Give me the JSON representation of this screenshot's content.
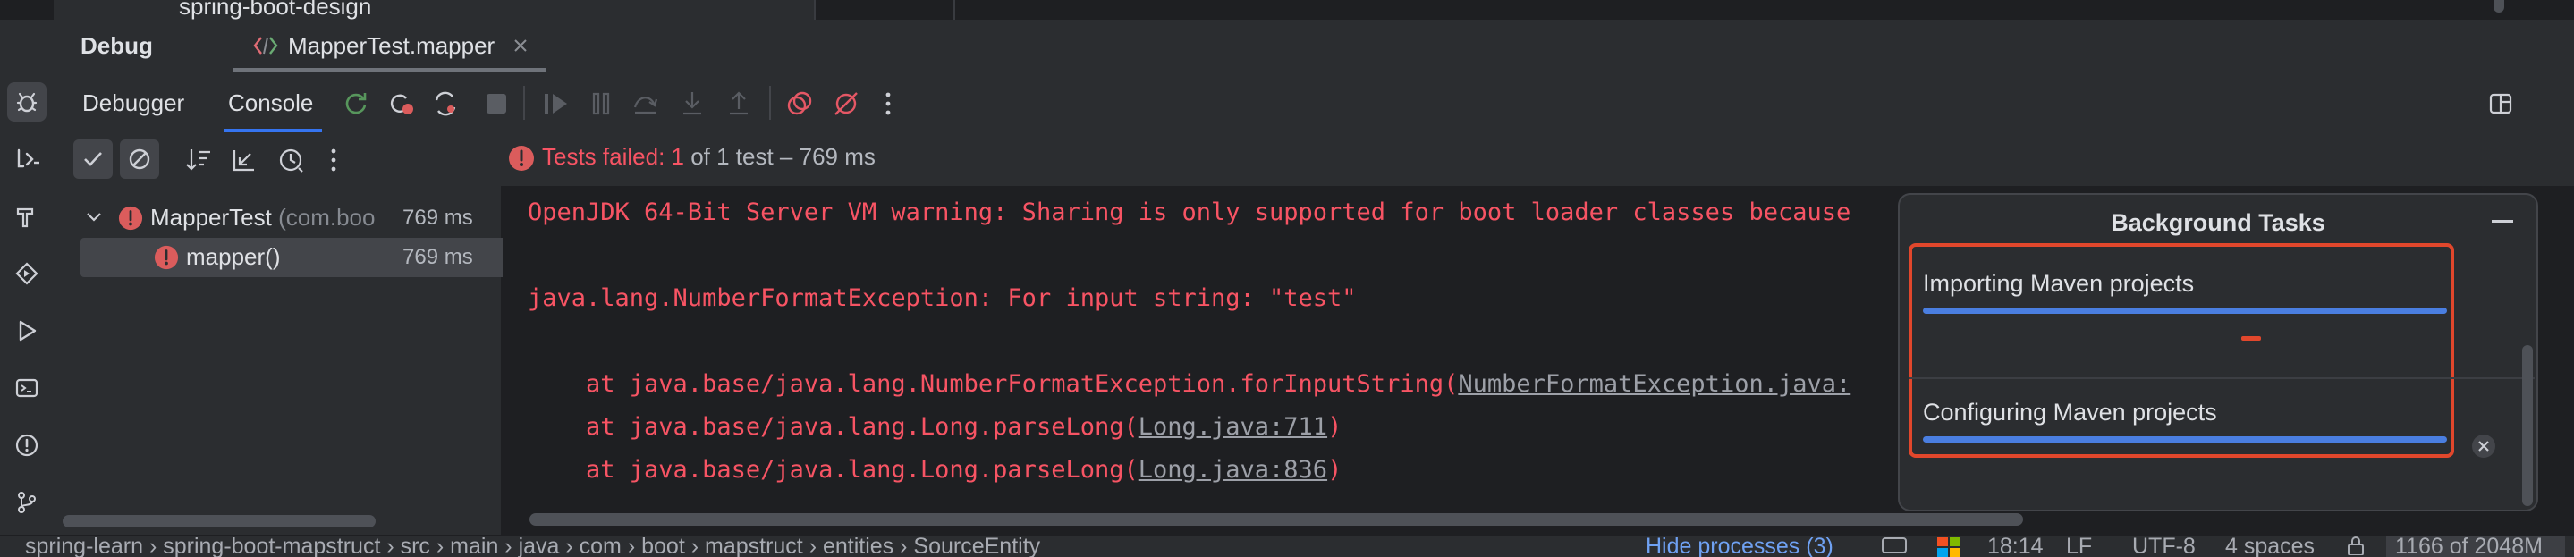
{
  "top": {
    "project_tree_remnant": "spring-boot-design"
  },
  "debug_panel": {
    "title": "Debug",
    "tab_label": "MapperTest.mapper",
    "tool_tabs": [
      "Debugger",
      "Console"
    ]
  },
  "runner": {
    "status_prefix": "Tests failed: 1",
    "status_rest": " of 1 test – 769 ms"
  },
  "test_tree": {
    "root_name": "MapperTest",
    "root_pkg": "(com.boo",
    "root_time": "769 ms",
    "child_name": "mapper()",
    "child_time": "769 ms"
  },
  "console": {
    "lines": [
      "OpenJDK 64-Bit Server VM warning: Sharing is only supported for boot loader classes because",
      "java.lang.NumberFormatException: For input string: \"test\""
    ],
    "trace": [
      {
        "prefix": "    at java.base/java.lang.NumberFormatException.forInputString(",
        "link": "NumberFormatException.java:",
        "suffix": ""
      },
      {
        "prefix": "    at java.base/java.lang.Long.parseLong(",
        "link": "Long.java:711",
        "suffix": ")"
      },
      {
        "prefix": "    at java.base/java.lang.Long.parseLong(",
        "link": "Long.java:836",
        "suffix": ")"
      }
    ]
  },
  "background_tasks": {
    "title": "Background Tasks",
    "tasks": [
      "Importing Maven projects",
      "Configuring Maven projects"
    ]
  },
  "status_bar": {
    "breadcrumb": [
      "spring-learn",
      "spring-boot-mapstruct",
      "src",
      "main",
      "java",
      "com",
      "boot",
      "mapstruct",
      "entities",
      "SourceEntity"
    ],
    "hide_processes": "Hide processes (3)",
    "position": "18:14",
    "line_sep": "LF",
    "encoding": "UTF-8",
    "indent": "4 spaces",
    "memory": "1166 of 2048M"
  },
  "colors": {
    "error": "#f75464",
    "accent": "#4a7ee0",
    "highlight_box": "#e1472c"
  },
  "icons": [
    "debug-icon",
    "run-icon",
    "terminal-icon",
    "problems-icon",
    "git-icon",
    "rerun-icon",
    "stop-icon",
    "resume-icon",
    "pause-icon",
    "step-over-icon",
    "step-into-icon",
    "step-out-icon",
    "breakpoints-icon",
    "mute-breakpoints-icon",
    "more-icon",
    "layout-icon",
    "minimize-icon",
    "cancel-icon",
    "error-icon"
  ]
}
